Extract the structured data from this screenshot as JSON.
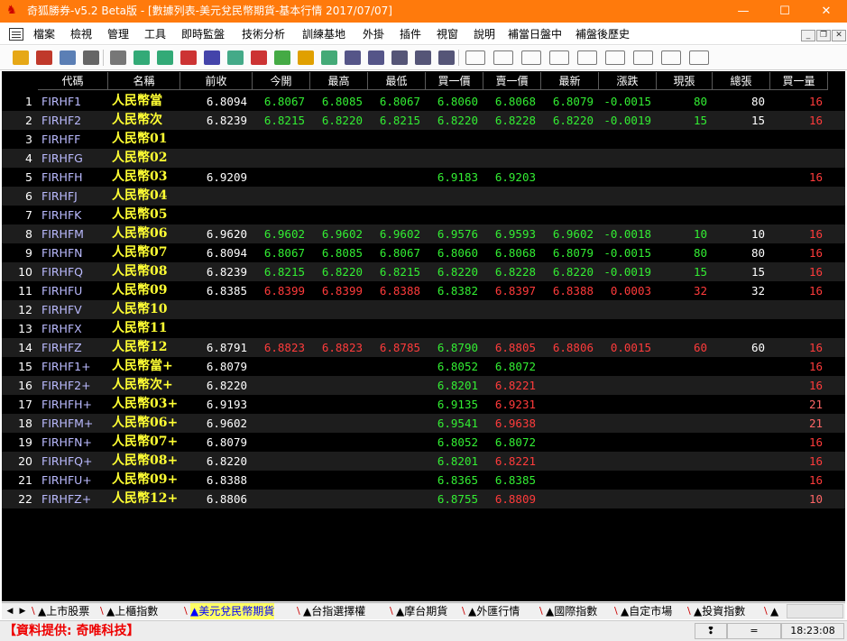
{
  "window": {
    "title": "奇狐勝券-v5.2 Beta版 - [數據列表-美元兌民幣期貨-基本行情 2017/07/07]"
  },
  "menu": [
    "檔案",
    "檢視",
    "管理",
    "工具",
    "即時監盤",
    "技術分析",
    "訓練基地",
    "外掛",
    "插件",
    "視窗",
    "說明",
    "補當日盤中",
    "補盤後歷史"
  ],
  "toolbar_icons": [
    "open-icon",
    "print-icon",
    "move-icon",
    "layout-icon",
    "grid-icon",
    "chart-icon",
    "chart2-icon",
    "list-icon",
    "copy-icon",
    "doc-icon",
    "mail-icon",
    "money-icon",
    "warning-icon",
    "swap-icon",
    "table-icon",
    "table2-icon",
    "window-icon",
    "window2-icon",
    "window3-icon",
    "draw-icon",
    "line-icon",
    "fib-icon",
    "bars-icon",
    "angle-icon",
    "fan-icon",
    "channel-icon",
    "rect-icon",
    "circle-icon"
  ],
  "columns": [
    "代碼",
    "名稱",
    "前收",
    "今開",
    "最高",
    "最低",
    "買一價",
    "賣一價",
    "最新",
    "漲跌",
    "現張",
    "總張",
    "買一量"
  ],
  "rows": [
    {
      "i": "1",
      "code": "FIRHF1",
      "name": "人民幣當",
      "prev": "6.8094",
      "open": "6.8067",
      "high": "6.8085",
      "low": "6.8067",
      "bid": "6.8060",
      "ask": "6.8068",
      "last": "6.8079",
      "chg": "-0.0015",
      "cur": "80",
      "tot": "80",
      "bq": "16",
      "tone": "green"
    },
    {
      "i": "2",
      "code": "FIRHF2",
      "name": "人民幣次",
      "prev": "6.8239",
      "open": "6.8215",
      "high": "6.8220",
      "low": "6.8215",
      "bid": "6.8220",
      "ask": "6.8228",
      "last": "6.8220",
      "chg": "-0.0019",
      "cur": "15",
      "tot": "15",
      "bq": "16",
      "tone": "green"
    },
    {
      "i": "3",
      "code": "FIRHFF",
      "name": "人民幣01",
      "prev": "",
      "open": "",
      "high": "",
      "low": "",
      "bid": "",
      "ask": "",
      "last": "",
      "chg": "",
      "cur": "",
      "tot": "",
      "bq": "",
      "tone": "green"
    },
    {
      "i": "4",
      "code": "FIRHFG",
      "name": "人民幣02",
      "prev": "",
      "open": "",
      "high": "",
      "low": "",
      "bid": "",
      "ask": "",
      "last": "",
      "chg": "",
      "cur": "",
      "tot": "",
      "bq": "",
      "tone": "green"
    },
    {
      "i": "5",
      "code": "FIRHFH",
      "name": "人民幣03",
      "prev": "6.9209",
      "open": "",
      "high": "",
      "low": "",
      "bid": "6.9183",
      "ask": "6.9203",
      "last": "",
      "chg": "",
      "cur": "",
      "tot": "",
      "bq": "16",
      "tone": "green"
    },
    {
      "i": "6",
      "code": "FIRHFJ",
      "name": "人民幣04",
      "prev": "",
      "open": "",
      "high": "",
      "low": "",
      "bid": "",
      "ask": "",
      "last": "",
      "chg": "",
      "cur": "",
      "tot": "",
      "bq": "",
      "tone": "green"
    },
    {
      "i": "7",
      "code": "FIRHFK",
      "name": "人民幣05",
      "prev": "",
      "open": "",
      "high": "",
      "low": "",
      "bid": "",
      "ask": "",
      "last": "",
      "chg": "",
      "cur": "",
      "tot": "",
      "bq": "",
      "tone": "green"
    },
    {
      "i": "8",
      "code": "FIRHFM",
      "name": "人民幣06",
      "prev": "6.9620",
      "open": "6.9602",
      "high": "6.9602",
      "low": "6.9602",
      "bid": "6.9576",
      "ask": "6.9593",
      "last": "6.9602",
      "chg": "-0.0018",
      "cur": "10",
      "tot": "10",
      "bq": "16",
      "tone": "green"
    },
    {
      "i": "9",
      "code": "FIRHFN",
      "name": "人民幣07",
      "prev": "6.8094",
      "open": "6.8067",
      "high": "6.8085",
      "low": "6.8067",
      "bid": "6.8060",
      "ask": "6.8068",
      "last": "6.8079",
      "chg": "-0.0015",
      "cur": "80",
      "tot": "80",
      "bq": "16",
      "tone": "green"
    },
    {
      "i": "10",
      "code": "FIRHFQ",
      "name": "人民幣08",
      "prev": "6.8239",
      "open": "6.8215",
      "high": "6.8220",
      "low": "6.8215",
      "bid": "6.8220",
      "ask": "6.8228",
      "last": "6.8220",
      "chg": "-0.0019",
      "cur": "15",
      "tot": "15",
      "bq": "16",
      "tone": "green"
    },
    {
      "i": "11",
      "code": "FIRHFU",
      "name": "人民幣09",
      "prev": "6.8385",
      "open": "6.8399",
      "high": "6.8399",
      "low": "6.8388",
      "bid": "6.8382",
      "ask": "6.8397",
      "last": "6.8388",
      "chg": "0.0003",
      "cur": "32",
      "tot": "32",
      "bq": "16",
      "tone": "red"
    },
    {
      "i": "12",
      "code": "FIRHFV",
      "name": "人民幣10",
      "prev": "",
      "open": "",
      "high": "",
      "low": "",
      "bid": "",
      "ask": "",
      "last": "",
      "chg": "",
      "cur": "",
      "tot": "",
      "bq": "",
      "tone": "green"
    },
    {
      "i": "13",
      "code": "FIRHFX",
      "name": "人民幣11",
      "prev": "",
      "open": "",
      "high": "",
      "low": "",
      "bid": "",
      "ask": "",
      "last": "",
      "chg": "",
      "cur": "",
      "tot": "",
      "bq": "",
      "tone": "green"
    },
    {
      "i": "14",
      "code": "FIRHFZ",
      "name": "人民幣12",
      "prev": "6.8791",
      "open": "6.8823",
      "high": "6.8823",
      "low": "6.8785",
      "bid": "6.8790",
      "ask": "6.8805",
      "last": "6.8806",
      "chg": "0.0015",
      "cur": "60",
      "tot": "60",
      "bq": "16",
      "tone": "red"
    },
    {
      "i": "15",
      "code": "FIRHF1+",
      "name": "人民幣當+",
      "prev": "6.8079",
      "open": "",
      "high": "",
      "low": "",
      "bid": "6.8052",
      "ask": "6.8072",
      "last": "",
      "chg": "",
      "cur": "",
      "tot": "",
      "bq": "16",
      "tone": "green"
    },
    {
      "i": "16",
      "code": "FIRHF2+",
      "name": "人民幣次+",
      "prev": "6.8220",
      "open": "",
      "high": "",
      "low": "",
      "bid": "6.8201",
      "ask": "6.8221",
      "last": "",
      "chg": "",
      "cur": "",
      "tot": "",
      "bq": "16",
      "tone": "mixed"
    },
    {
      "i": "17",
      "code": "FIRHFH+",
      "name": "人民幣03+",
      "prev": "6.9193",
      "open": "",
      "high": "",
      "low": "",
      "bid": "6.9135",
      "ask": "6.9231",
      "last": "",
      "chg": "",
      "cur": "",
      "tot": "",
      "bq": "21",
      "tone": "mixed"
    },
    {
      "i": "18",
      "code": "FIRHFM+",
      "name": "人民幣06+",
      "prev": "6.9602",
      "open": "",
      "high": "",
      "low": "",
      "bid": "6.9541",
      "ask": "6.9638",
      "last": "",
      "chg": "",
      "cur": "",
      "tot": "",
      "bq": "21",
      "tone": "mixed"
    },
    {
      "i": "19",
      "code": "FIRHFN+",
      "name": "人民幣07+",
      "prev": "6.8079",
      "open": "",
      "high": "",
      "low": "",
      "bid": "6.8052",
      "ask": "6.8072",
      "last": "",
      "chg": "",
      "cur": "",
      "tot": "",
      "bq": "16",
      "tone": "green"
    },
    {
      "i": "20",
      "code": "FIRHFQ+",
      "name": "人民幣08+",
      "prev": "6.8220",
      "open": "",
      "high": "",
      "low": "",
      "bid": "6.8201",
      "ask": "6.8221",
      "last": "",
      "chg": "",
      "cur": "",
      "tot": "",
      "bq": "16",
      "tone": "mixed"
    },
    {
      "i": "21",
      "code": "FIRHFU+",
      "name": "人民幣09+",
      "prev": "6.8388",
      "open": "",
      "high": "",
      "low": "",
      "bid": "6.8365",
      "ask": "6.8385",
      "last": "",
      "chg": "",
      "cur": "",
      "tot": "",
      "bq": "16",
      "tone": "green"
    },
    {
      "i": "22",
      "code": "FIRHFZ+",
      "name": "人民幣12+",
      "prev": "6.8806",
      "open": "",
      "high": "",
      "low": "",
      "bid": "6.8755",
      "ask": "6.8809",
      "last": "",
      "chg": "",
      "cur": "",
      "tot": "",
      "bq": "10",
      "tone": "mixed"
    }
  ],
  "tabs": [
    {
      "label": "▲上市股票",
      "active": false
    },
    {
      "label": "▲上櫃指數",
      "active": false
    },
    {
      "label": "▲美元兌民幣期貨",
      "active": true
    },
    {
      "label": "▲台指選擇權",
      "active": false
    },
    {
      "label": "▲摩台期貨",
      "active": false
    },
    {
      "label": "▲外匯行情",
      "active": false
    },
    {
      "label": "▲國際指數",
      "active": false
    },
    {
      "label": "▲自定市場",
      "active": false
    },
    {
      "label": "▲投資指數",
      "active": false
    },
    {
      "label": "▲",
      "active": false
    }
  ],
  "status": {
    "provider": "【資料提供: 奇唯科技】",
    "eq": "=",
    "time": "18:23:08"
  },
  "colors": {
    "titlebar": "#ff7a0c",
    "green": "#33ee33",
    "red": "#ff3b3b",
    "name": "#ffff33",
    "code": "#bbbbff"
  }
}
